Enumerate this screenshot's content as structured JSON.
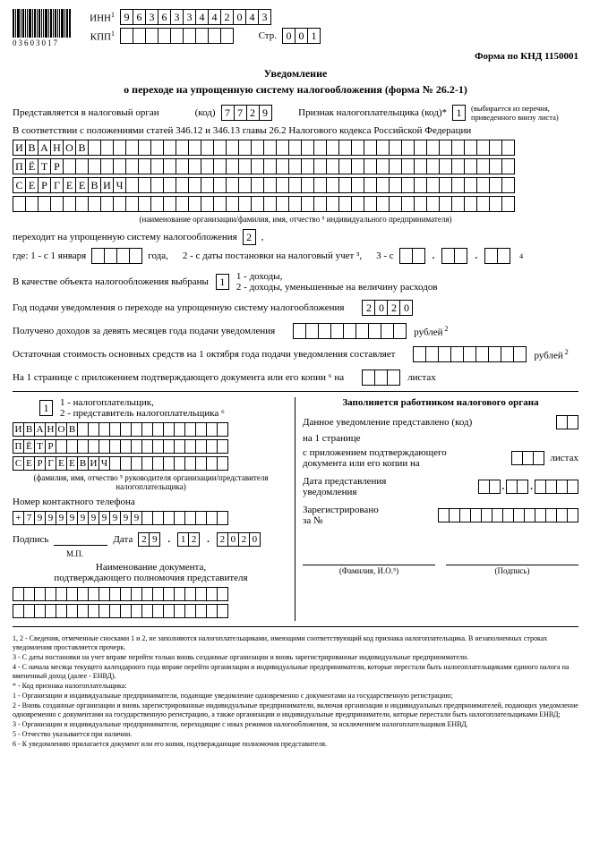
{
  "barcode_num": "03603017",
  "inn_label": "ИНН",
  "inn": [
    "9",
    "6",
    "3",
    "6",
    "3",
    "3",
    "4",
    "4",
    "2",
    "0",
    "4",
    "3"
  ],
  "kpp_label": "КПП",
  "kpp": [
    "",
    "",
    "",
    "",
    "",
    "",
    "",
    "",
    ""
  ],
  "str_label": "Стр.",
  "str": [
    "0",
    "0",
    "1"
  ],
  "knd": "Форма по КНД 1150001",
  "title1": "Уведомление",
  "title2": "о переходе на упрощенную систему налогообложения (форма № 26.2-1)",
  "presented_label": "Представляется в налоговый орган",
  "kod_label": "(код)",
  "tax_code": [
    "7",
    "7",
    "2",
    "9"
  ],
  "priznak_label": "Признак налогоплательщика (код)*",
  "priznak": [
    "1"
  ],
  "priznak_hint": "(выбирается из перечня, приведенного внизу листа)",
  "accord": "В соответствии с положениями статей 346.12 и 346.13 главы 26.2 Налогового кодекса Российской Федерации",
  "name_rows": [
    [
      "И",
      "В",
      "А",
      "Н",
      "О",
      "В",
      "",
      "",
      "",
      "",
      "",
      "",
      "",
      "",
      "",
      "",
      "",
      "",
      "",
      "",
      "",
      "",
      "",
      "",
      "",
      "",
      "",
      "",
      "",
      "",
      "",
      "",
      "",
      "",
      "",
      "",
      "",
      "",
      "",
      ""
    ],
    [
      "П",
      "Ё",
      "Т",
      "Р",
      "",
      "",
      "",
      "",
      "",
      "",
      "",
      "",
      "",
      "",
      "",
      "",
      "",
      "",
      "",
      "",
      "",
      "",
      "",
      "",
      "",
      "",
      "",
      "",
      "",
      "",
      "",
      "",
      "",
      "",
      "",
      "",
      "",
      "",
      "",
      ""
    ],
    [
      "С",
      "Е",
      "Р",
      "Г",
      "Е",
      "Е",
      "В",
      "И",
      "Ч",
      "",
      "",
      "",
      "",
      "",
      "",
      "",
      "",
      "",
      "",
      "",
      "",
      "",
      "",
      "",
      "",
      "",
      "",
      "",
      "",
      "",
      "",
      "",
      "",
      "",
      "",
      "",
      "",
      "",
      "",
      ""
    ],
    [
      "",
      "",
      "",
      "",
      "",
      "",
      "",
      "",
      "",
      "",
      "",
      "",
      "",
      "",
      "",
      "",
      "",
      "",
      "",
      "",
      "",
      "",
      "",
      "",
      "",
      "",
      "",
      "",
      "",
      "",
      "",
      "",
      "",
      "",
      "",
      "",
      "",
      "",
      "",
      ""
    ]
  ],
  "name_cap": "(наименование организации/фамилия, имя, отчество ⁵ индивидуального предпринимателя)",
  "trans_label": "переходит на упрощенную систему налогообложения",
  "trans_code": [
    "2"
  ],
  "trans_comma": ",",
  "where_label": "где: 1 - с 1 января",
  "year4": [
    "",
    "",
    "",
    ""
  ],
  "goda": "года,",
  "where2": "2 - с даты постановки на налоговый учет ³,",
  "where3": "3 - с",
  "date_blank2": [
    "",
    ""
  ],
  "sup4": "4",
  "obj_label": "В качестве объекта налогообложения выбраны",
  "obj_code": [
    "1"
  ],
  "obj_opts1": "1 - доходы,",
  "obj_opts2": "2 - доходы, уменьшенные на величину расходов",
  "year_label": "Год подачи уведомления о переходе на упрощенную систему налогообложения",
  "year": [
    "2",
    "0",
    "2",
    "0"
  ],
  "income_label": "Получено доходов за девять месяцев года подачи уведомления",
  "income": [
    "",
    "",
    "",
    "",
    "",
    "",
    "",
    "",
    ""
  ],
  "rub": "рублей",
  "ost_label": "Остаточная стоимость основных средств на 1 октября года подачи уведомления составляет",
  "ost": [
    "",
    "",
    "",
    "",
    "",
    "",
    "",
    "",
    ""
  ],
  "attach_label_1": "На 1 странице с приложением подтверждающего документа или его копии ⁶ на",
  "attach": [
    "",
    "",
    ""
  ],
  "listah": "листах",
  "who_code": [
    "1"
  ],
  "who_opts1": "1 - налогоплательщик,",
  "who_opts2": "2 - представитель налогоплательщика ⁶",
  "sign_name": [
    [
      "И",
      "В",
      "А",
      "Н",
      "О",
      "В",
      "",
      "",
      "",
      "",
      "",
      "",
      "",
      "",
      "",
      "",
      "",
      "",
      "",
      ""
    ],
    [
      "П",
      "Ё",
      "Т",
      "Р",
      "",
      "",
      "",
      "",
      "",
      "",
      "",
      "",
      "",
      "",
      "",
      "",
      "",
      "",
      "",
      ""
    ],
    [
      "С",
      "Е",
      "Р",
      "Г",
      "Е",
      "Е",
      "В",
      "И",
      "Ч",
      "",
      "",
      "",
      "",
      "",
      "",
      "",
      "",
      "",
      "",
      ""
    ]
  ],
  "sign_cap": "(фамилия, имя, отчество ⁵ руководителя организации/представителя налогоплательщика)",
  "phone_label": "Номер контактного телефона",
  "phone": [
    "+",
    "7",
    "9",
    "9",
    "9",
    "9",
    "9",
    "9",
    "9",
    "9",
    "9",
    "9",
    "",
    "",
    "",
    "",
    "",
    "",
    "",
    ""
  ],
  "sign_label": "Подпись",
  "mp": "М.П.",
  "date_label": "Дата",
  "date_d": [
    "2",
    "9"
  ],
  "date_m": [
    "1",
    "2"
  ],
  "date_y": [
    "2",
    "0",
    "2",
    "0"
  ],
  "doc_cap1": "Наименование документа,",
  "doc_cap2": "подтверждающего полномочия представителя",
  "doc_rows": [
    [
      "",
      "",
      "",
      "",
      "",
      "",
      "",
      "",
      "",
      "",
      "",
      "",
      "",
      "",
      "",
      "",
      "",
      "",
      "",
      ""
    ],
    [
      "",
      "",
      "",
      "",
      "",
      "",
      "",
      "",
      "",
      "",
      "",
      "",
      "",
      "",
      "",
      "",
      "",
      "",
      "",
      ""
    ]
  ],
  "right_title": "Заполняется работником налогового органа",
  "r_presented": "Данное уведомление представлено (код)",
  "r_presented_code": [
    "",
    ""
  ],
  "r_page": "на 1 странице",
  "r_attach1": "с приложением подтверждающего",
  "r_attach2": "документа или его копии на",
  "r_attach_code": [
    "",
    "",
    ""
  ],
  "r_date_label1": "Дата представления",
  "r_date_label2": "уведомления",
  "r_reg1": "Зарегистрировано",
  "r_reg2": "за №",
  "r_reg_code": [
    "",
    "",
    "",
    "",
    "",
    "",
    "",
    "",
    "",
    "",
    "",
    "",
    ""
  ],
  "sig_fio": "(Фамилия, И.О.⁵)",
  "sig_pod": "(Подпись)",
  "notes": [
    "1, 2 - Сведения, отмеченные сносками 1 и 2, не заполняются налогоплательщиками, имеющими соответствующий код признака налогоплательщика. В незаполненных строках уведомления проставляется прочерк.",
    "3 - С даты постановки на учет вправе перейти только вновь созданные организации и вновь зарегистрированные индивидуальные предприниматели.",
    "4 - С начала месяца текущего календарного года вправе перейти организации и индивидуальные предприниматели, которые перестали быть налогоплательщиками единого налога на вмененный доход (далее - ЕНВД).",
    "* - Код признака налогоплательщика:",
    "1 - Организации и индивидуальные предприниматели, подающие уведомление одновременно с документами на государственную регистрацию;",
    "2 - Вновь созданные организации и вновь зарегистрированные индивидуальные предприниматели, включая организации и индивидуальных предпринимателей, подающих уведомление одновременно с документами на государственную регистрацию, а также организации и индивидуальные предприниматели, которые перестали быть налогоплательщиками ЕНВД;",
    "3 - Организации и индивидуальные предприниматели, переходящие с иных режимов налогообложения, за исключением налогоплательщиков ЕНВД.",
    "5 - Отчество указывается при наличии.",
    "6 - К уведомлению прилагается документ или его копия, подтверждающие полномочия представителя."
  ]
}
